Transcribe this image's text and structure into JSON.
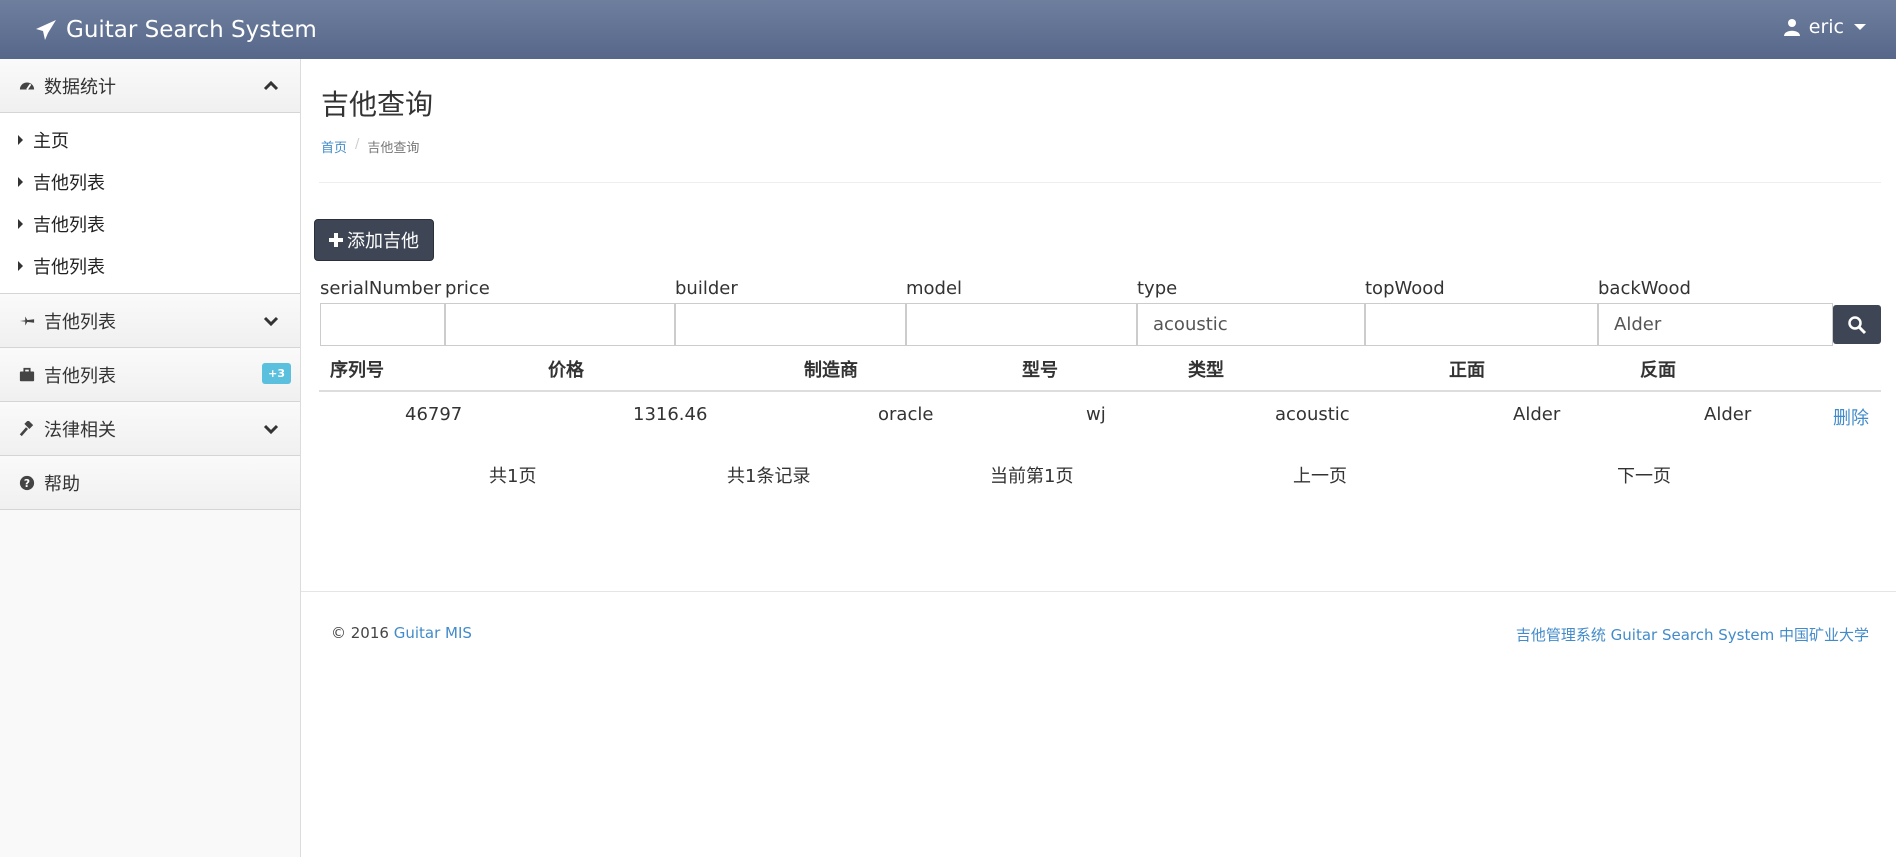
{
  "app": {
    "title": "Guitar Search System",
    "user": "eric"
  },
  "sidebar": {
    "sections": [
      {
        "label": "数据统计",
        "icon": "dashboard-icon",
        "expanded": true,
        "items": [
          {
            "label": "主页"
          },
          {
            "label": "吉他列表"
          },
          {
            "label": "吉他列表"
          },
          {
            "label": "吉他列表"
          }
        ]
      },
      {
        "label": "吉他列表",
        "icon": "plane-icon"
      },
      {
        "label": "吉他列表",
        "icon": "briefcase-icon",
        "badge": "+3"
      },
      {
        "label": "法律相关",
        "icon": "gavel-icon"
      },
      {
        "label": "帮助",
        "icon": "question-icon"
      }
    ]
  },
  "main": {
    "title": "吉他查询",
    "breadcrumb": {
      "home": "首页",
      "current": "吉他查询"
    },
    "add_button": "添加吉他",
    "search": {
      "labels": [
        "serialNumber",
        "price",
        "builder",
        "model",
        "type",
        "topWood",
        "backWood"
      ],
      "values": [
        "",
        "",
        "",
        "",
        "acoustic",
        "",
        "Alder"
      ]
    },
    "table": {
      "headers": [
        "序列号",
        "价格",
        "制造商",
        "型号",
        "类型",
        "正面",
        "反面"
      ],
      "rows": [
        {
          "serial": "46797",
          "price": "1316.46",
          "builder": "oracle",
          "model": "wj",
          "type": "acoustic",
          "top": "Alder",
          "back": "Alder",
          "action": "删除"
        }
      ]
    },
    "pager": {
      "total_pages": "共1页",
      "total_records": "共1条记录",
      "current": "当前第1页",
      "prev": "上一页",
      "next": "下一页"
    }
  },
  "footer": {
    "copyright": "© 2016",
    "brand": "Guitar MIS",
    "right": "吉他管理系统 Guitar Search System 中国矿业大学"
  },
  "colors": {
    "navbar": "#5e6f91",
    "dark_button": "#3e4554",
    "link": "#428bca",
    "badge": "#5bc0de"
  }
}
